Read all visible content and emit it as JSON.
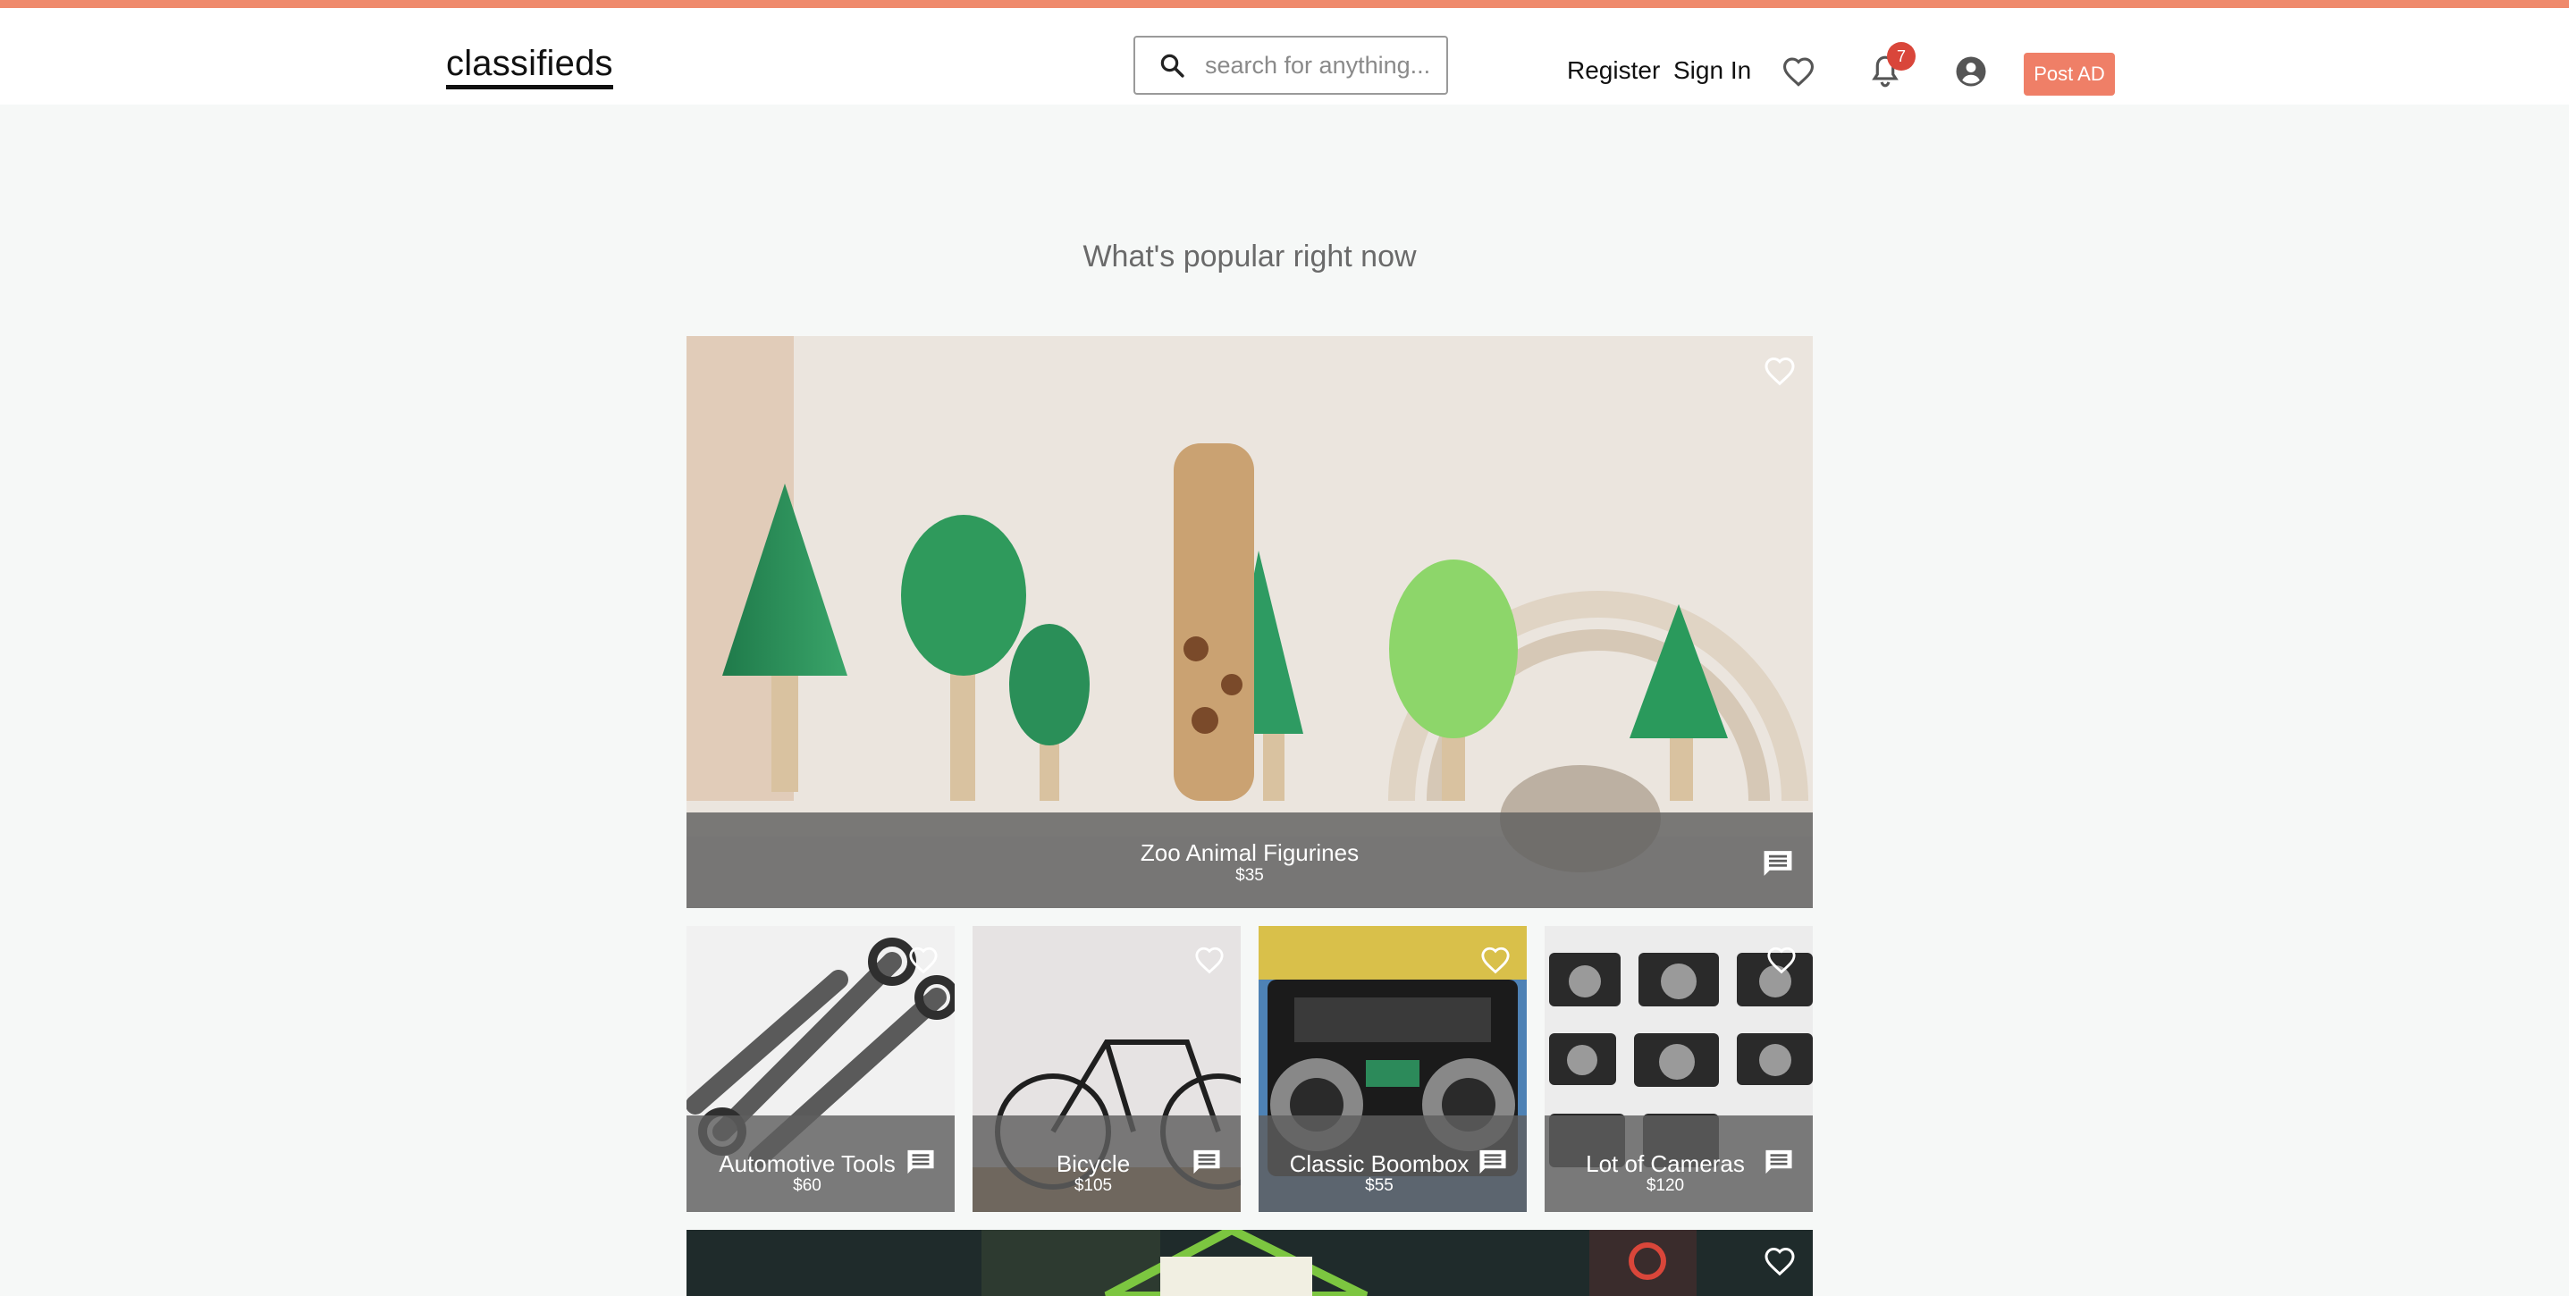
{
  "header": {
    "logo": "classifieds",
    "search_placeholder": "search for anything...",
    "register_label": "Register",
    "signin_label": "Sign In",
    "notification_count": "7",
    "post_ad_label": "Post AD"
  },
  "colors": {
    "accent": "#ef8a6c",
    "post_button": "#ef7f67",
    "badge": "#d9463a",
    "background": "#f6f8f7"
  },
  "main": {
    "section_title": "What's popular right now",
    "featured": {
      "title": "Zoo Animal Figurines",
      "price": "$35"
    },
    "listings": [
      {
        "title": "Automotive Tools",
        "price": "$60"
      },
      {
        "title": "Bicycle",
        "price": "$105"
      },
      {
        "title": "Classic Boombox",
        "price": "$55"
      },
      {
        "title": "Lot of Cameras",
        "price": "$120"
      }
    ]
  }
}
